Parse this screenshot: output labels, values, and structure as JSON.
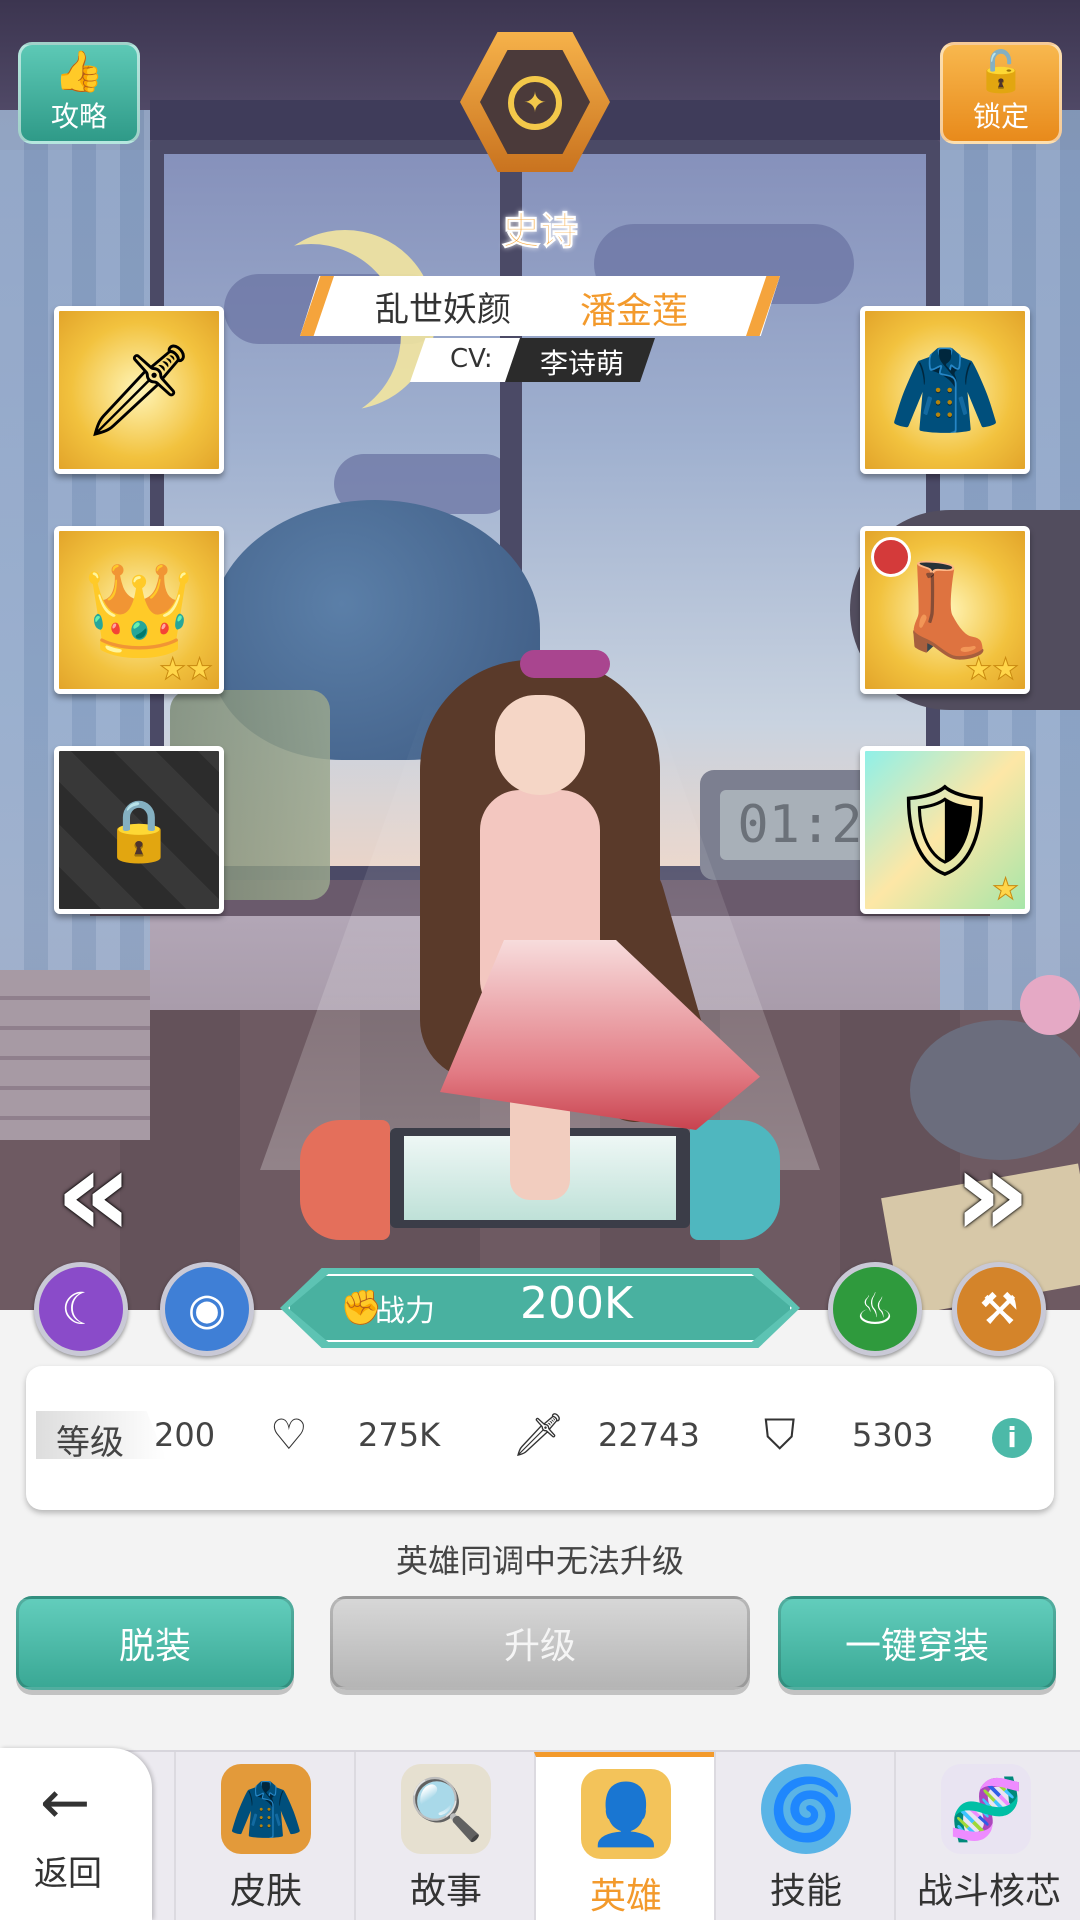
{
  "top": {
    "guide_label": "攻略",
    "lock_label": "锁定",
    "rarity_label": "史诗"
  },
  "hero": {
    "title": "乱世妖颜",
    "name": "潘金莲",
    "cv_label": "CV:",
    "cv_name": "李诗萌"
  },
  "scene": {
    "clock_text": "01:2"
  },
  "equipment": {
    "left": [
      {
        "icon": "sword-icon",
        "stars": 0
      },
      {
        "icon": "helmet-icon",
        "stars": 2
      },
      {
        "icon": "lock-icon",
        "locked": true
      }
    ],
    "right": [
      {
        "icon": "armor-icon",
        "stars": 0
      },
      {
        "icon": "boots-icon",
        "stars": 2
      },
      {
        "icon": "emblem-icon",
        "stars": 1
      }
    ]
  },
  "power": {
    "label": "战力",
    "value": "200K"
  },
  "elements": [
    {
      "icon": "moon-icon",
      "color": "#8a4bc9"
    },
    {
      "icon": "mind-icon",
      "color": "#3f7fd6"
    },
    {
      "icon": "flame-icon",
      "color": "#2f9a3d"
    },
    {
      "icon": "hammer-icon",
      "color": "#d4842a"
    }
  ],
  "stats": {
    "level_label": "等级",
    "level": "200",
    "hp": "275K",
    "attack": "22743",
    "defense": "5303"
  },
  "message": "英雄同调中无法升级",
  "actions": {
    "unequip": "脱装",
    "upgrade": "升级",
    "equip_all": "一键穿装"
  },
  "nav": {
    "back": "返回",
    "tabs": [
      {
        "label": "皮肤",
        "icon": "coat-icon"
      },
      {
        "label": "故事",
        "icon": "magnifier-book-icon"
      },
      {
        "label": "英雄",
        "icon": "hero-card-icon",
        "active": true
      },
      {
        "label": "技能",
        "icon": "vortex-icon"
      },
      {
        "label": "战斗核芯",
        "icon": "dna-icon"
      }
    ]
  },
  "colors": {
    "accent_teal": "#4cb9a8",
    "accent_orange": "#f39a2c"
  }
}
